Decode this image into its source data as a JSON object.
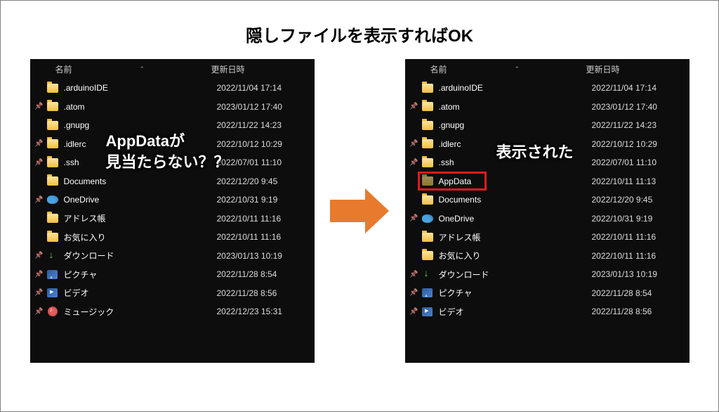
{
  "title": "隠しファイルを表示すればOK",
  "columns": {
    "name": "名前",
    "date": "更新日時"
  },
  "left_overlay": "AppDataが\n見当たらない？？",
  "right_overlay": "表示された",
  "left_panel": {
    "rows": [
      {
        "pin": false,
        "icon": "folder",
        "name": ".arduinoIDE",
        "date": "2022/11/04 17:14"
      },
      {
        "pin": true,
        "icon": "folder",
        "name": ".atom",
        "date": "2023/01/12 17:40"
      },
      {
        "pin": false,
        "icon": "folder",
        "name": ".gnupg",
        "date": "2022/11/22 14:23"
      },
      {
        "pin": true,
        "icon": "folder",
        "name": ".idlerc",
        "date": "2022/10/12 10:29"
      },
      {
        "pin": true,
        "icon": "folder",
        "name": ".ssh",
        "date": "2022/07/01 11:10"
      },
      {
        "pin": false,
        "icon": "folder",
        "name": "Documents",
        "date": "2022/12/20 9:45"
      },
      {
        "pin": true,
        "icon": "onedrive",
        "name": "OneDrive",
        "date": "2022/10/31 9:19"
      },
      {
        "pin": false,
        "icon": "folder",
        "name": "アドレス帳",
        "date": "2022/10/11 11:16"
      },
      {
        "pin": false,
        "icon": "folder",
        "name": "お気に入り",
        "date": "2022/10/11 11:16"
      },
      {
        "pin": true,
        "icon": "download",
        "name": "ダウンロード",
        "date": "2023/01/13 10:19"
      },
      {
        "pin": true,
        "icon": "pictures",
        "name": "ピクチャ",
        "date": "2022/11/28 8:54"
      },
      {
        "pin": true,
        "icon": "video",
        "name": "ビデオ",
        "date": "2022/11/28 8:56"
      },
      {
        "pin": true,
        "icon": "music",
        "name": "ミュージック",
        "date": "2022/12/23 15:31"
      }
    ]
  },
  "right_panel": {
    "highlight_index": 5,
    "rows": [
      {
        "pin": false,
        "icon": "folder",
        "name": ".arduinoIDE",
        "date": "2022/11/04 17:14"
      },
      {
        "pin": true,
        "icon": "folder",
        "name": ".atom",
        "date": "2023/01/12 17:40"
      },
      {
        "pin": false,
        "icon": "folder",
        "name": ".gnupg",
        "date": "2022/11/22 14:23"
      },
      {
        "pin": true,
        "icon": "folder",
        "name": ".idlerc",
        "date": "2022/10/12 10:29"
      },
      {
        "pin": true,
        "icon": "folder",
        "name": ".ssh",
        "date": "2022/07/01 11:10"
      },
      {
        "pin": false,
        "icon": "folder-dim",
        "name": "AppData",
        "date": "2022/10/11 11:13"
      },
      {
        "pin": false,
        "icon": "folder",
        "name": "Documents",
        "date": "2022/12/20 9:45"
      },
      {
        "pin": true,
        "icon": "onedrive",
        "name": "OneDrive",
        "date": "2022/10/31 9:19"
      },
      {
        "pin": false,
        "icon": "folder",
        "name": "アドレス帳",
        "date": "2022/10/11 11:16"
      },
      {
        "pin": false,
        "icon": "folder",
        "name": "お気に入り",
        "date": "2022/10/11 11:16"
      },
      {
        "pin": true,
        "icon": "download",
        "name": "ダウンロード",
        "date": "2023/01/13 10:19"
      },
      {
        "pin": true,
        "icon": "pictures",
        "name": "ピクチャ",
        "date": "2022/11/28 8:54"
      },
      {
        "pin": true,
        "icon": "video",
        "name": "ビデオ",
        "date": "2022/11/28 8:56"
      }
    ]
  }
}
